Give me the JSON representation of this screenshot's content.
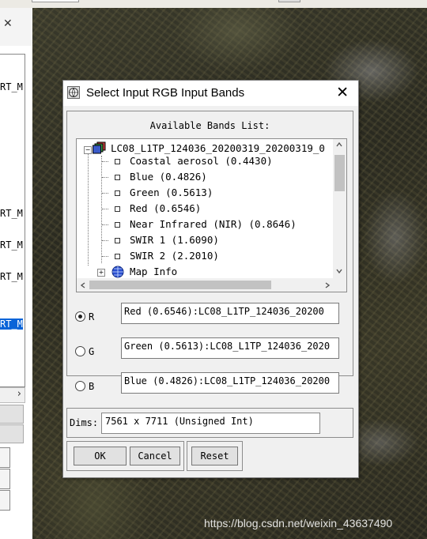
{
  "background_window": {
    "close_glyph": "✕",
    "list_items": [
      "RT_M",
      "RT_M",
      "RT_M",
      "RT_M",
      "RT_M"
    ],
    "scroll_right_glyph": "›"
  },
  "dialog": {
    "title": "Select Input RGB Input Bands",
    "close_glyph": "✕",
    "available_label": "Available Bands List:",
    "tree": {
      "root": "LC08_L1TP_124036_20200319_20200319_0",
      "bands": [
        "Coastal aerosol (0.4430)",
        "Blue (0.4826)",
        "Green (0.5613)",
        "Red (0.6546)",
        "Near Infrared (NIR) (0.8646)",
        "SWIR 1 (1.6090)",
        "SWIR 2 (2.2010)"
      ],
      "map_info": "Map Info",
      "expand_glyph": "+",
      "collapse_glyph": "−"
    },
    "channels": [
      {
        "label": "R",
        "value": "Red (0.6546):LC08_L1TP_124036_20200",
        "selected": true
      },
      {
        "label": "G",
        "value": "Green (0.5613):LC08_L1TP_124036_2020",
        "selected": false
      },
      {
        "label": "B",
        "value": "Blue (0.4826):LC08_L1TP_124036_20200",
        "selected": false
      }
    ],
    "dims_label": "Dims:",
    "dims_value": "7561 x 7711 (Unsigned Int)",
    "buttons": {
      "ok": "OK",
      "cancel": "Cancel",
      "reset": "Reset"
    }
  },
  "watermark": "https://blog.csdn.net/weixin_43637490",
  "colors": {
    "selection": "#0a64d8",
    "dialog_bg": "#f0f0f0"
  }
}
